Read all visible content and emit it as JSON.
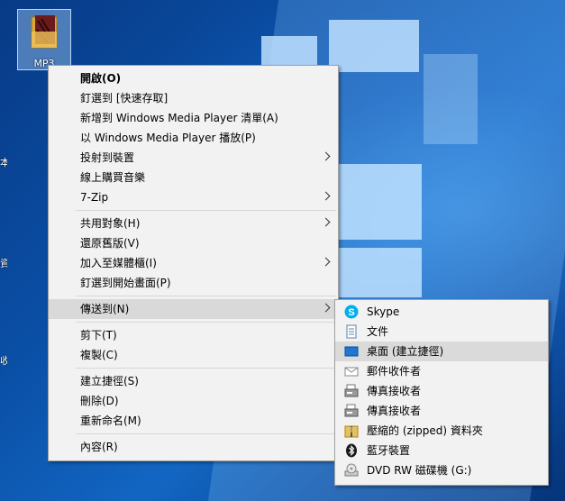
{
  "desktop": {
    "icon_label": "MP3",
    "edge_chars": [
      "本",
      "資",
      "收"
    ]
  },
  "context_menu": {
    "items": [
      {
        "label": "開啟(O)",
        "bold": true
      },
      {
        "label": "釘選到 [快速存取]"
      },
      {
        "label": "新增到 Windows Media Player 清單(A)"
      },
      {
        "label": "以 Windows Media Player 播放(P)"
      },
      {
        "label": "投射到裝置",
        "submenu": true
      },
      {
        "label": "線上購買音樂"
      },
      {
        "label": "7-Zip",
        "submenu": true
      },
      {
        "label": "共用對象(H)",
        "submenu": true
      },
      {
        "label": "還原舊版(V)"
      },
      {
        "label": "加入至媒體櫃(I)",
        "submenu": true
      },
      {
        "label": "釘選到開始畫面(P)"
      },
      {
        "label": "傳送到(N)",
        "submenu": true,
        "selected": true
      },
      {
        "label": "剪下(T)"
      },
      {
        "label": "複製(C)"
      },
      {
        "label": "建立捷徑(S)"
      },
      {
        "label": "刪除(D)"
      },
      {
        "label": "重新命名(M)"
      },
      {
        "label": "內容(R)"
      }
    ]
  },
  "sendto_menu": {
    "items": [
      {
        "label": "Skype",
        "icon": "skype-icon"
      },
      {
        "label": "文件",
        "icon": "document-icon"
      },
      {
        "label": "桌面 (建立捷徑)",
        "icon": "desktop-icon",
        "selected": true
      },
      {
        "label": "郵件收件者",
        "icon": "mail-icon"
      },
      {
        "label": "傳真接收者",
        "icon": "fax-icon"
      },
      {
        "label": "傳真接收者",
        "icon": "fax-icon"
      },
      {
        "label": "壓縮的 (zipped) 資料夾",
        "icon": "zip-folder-icon"
      },
      {
        "label": "藍牙裝置",
        "icon": "bluetooth-icon"
      },
      {
        "label": "DVD RW 磁碟機 (G:)",
        "icon": "dvd-drive-icon"
      }
    ]
  },
  "colors": {
    "menu_bg": "#f2f2f2",
    "highlight": "#d9d9d9",
    "skype": "#00aff0",
    "desktop_blue": "#0b4a9c"
  }
}
